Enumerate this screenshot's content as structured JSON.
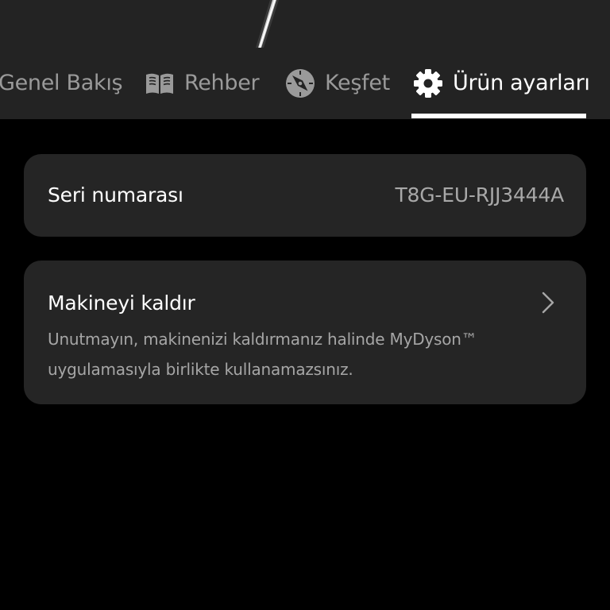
{
  "tabs": {
    "overview": {
      "label": "Genel Bakış",
      "icon": "none"
    },
    "guide": {
      "label": "Rehber",
      "icon": "book-icon"
    },
    "explore": {
      "label": "Keşfet",
      "icon": "compass-icon"
    },
    "settings": {
      "label": "Ürün ayarları",
      "icon": "gear-icon",
      "active": true
    }
  },
  "serial": {
    "label": "Seri numarası",
    "value": "T8G-EU-RJJ3444A"
  },
  "remove_machine": {
    "title": "Makineyi kaldır",
    "description": "Unutmayın, makinenizi kaldırmanız halinde MyDyson™ uygulamasıyla birlikte kullanamazsınız."
  },
  "colors": {
    "background": "#000000",
    "header_bg": "#232323",
    "card_bg": "#252525",
    "text_primary": "#ffffff",
    "text_secondary": "#a6a6a6",
    "tab_inactive": "#9a9a9a"
  }
}
